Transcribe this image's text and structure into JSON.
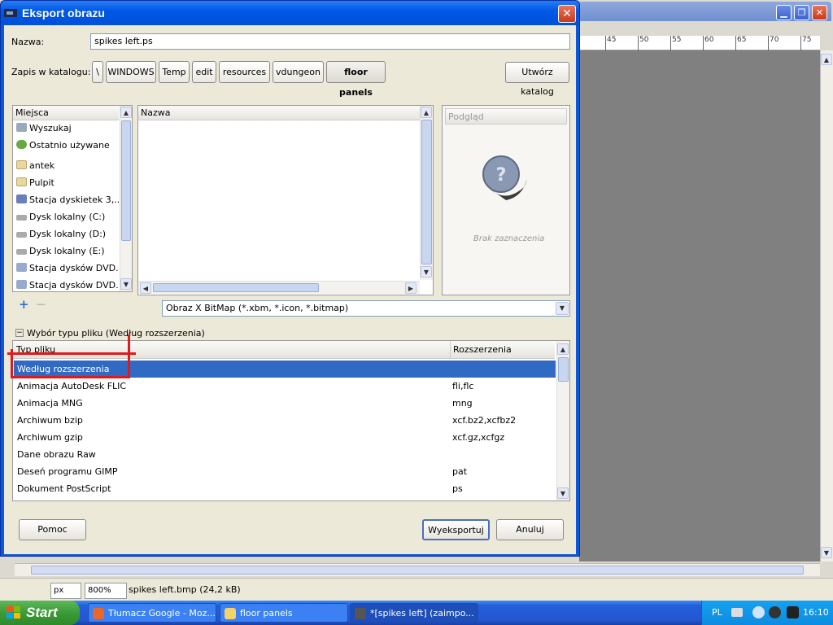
{
  "dialog": {
    "title": "Eksport obrazu",
    "close_label": "✕",
    "name_label": "Nazwa:",
    "name_value": "spikes left.ps",
    "folder_label": "Zapis w katalogu:",
    "breadcrumbs": [
      "\\",
      "WINDOWS",
      "Temp",
      "edit",
      "resources",
      "vdungeon",
      "floor panels"
    ],
    "create_folder": "Utwórz katalog",
    "places_header": "Miejsca",
    "places": [
      "Wyszukaj",
      "Ostatnio używane",
      "antek",
      "Pulpit",
      "Stacja dyskietek 3,...",
      "Dysk lokalny (C:)",
      "Dysk lokalny (D:)",
      "Dysk lokalny (E:)",
      "Stacja dysków DVD...",
      "Stacja dysków DVD..."
    ],
    "add_label": "+",
    "remove_label": "—",
    "files_header": "Nazwa",
    "preview_header": "Podgląd",
    "preview_empty": "Brak zaznaczenia",
    "filter_value": "Obraz X BitMap (*.xbm, *.icon, *.bitmap)",
    "filetype_toggle": "⊟",
    "filetype_label": "Wybór typu pliku (Według rozszerzenia)",
    "type_col": "Typ pliku",
    "ext_col": "Rozszerzenia",
    "filetypes": [
      {
        "name": "Według rozszerzenia",
        "ext": ""
      },
      {
        "name": "Animacja AutoDesk FLIC",
        "ext": "fli,flc"
      },
      {
        "name": "Animacja MNG",
        "ext": "mng"
      },
      {
        "name": "Archiwum bzip",
        "ext": "xcf.bz2,xcfbz2"
      },
      {
        "name": "Archiwum gzip",
        "ext": "xcf.gz,xcfgz"
      },
      {
        "name": "Dane obrazu Raw",
        "ext": ""
      },
      {
        "name": "Deseń programu GIMP",
        "ext": "pat"
      },
      {
        "name": "Dokument PostScript",
        "ext": "ps"
      }
    ],
    "help_btn": "Pomoc",
    "export_btn": "Wyeksportuj",
    "cancel_btn": "Anuluj"
  },
  "background": {
    "ruler_ticks": [
      "45",
      "50",
      "55",
      "60",
      "65",
      "70",
      "75"
    ],
    "unit": "px",
    "zoom": "800%",
    "status_file": "spikes left.bmp (24,2 kB)"
  },
  "taskbar": {
    "start": "Start",
    "tasks": [
      "Tłumacz Google - Moz...",
      "floor panels",
      "*[spikes left] (zaimpo..."
    ],
    "lang": "PL",
    "clock": "16:10"
  },
  "colors": {
    "selection": "#316ac5",
    "annotation": "#e0191b",
    "titlebar": "#0058e6"
  }
}
